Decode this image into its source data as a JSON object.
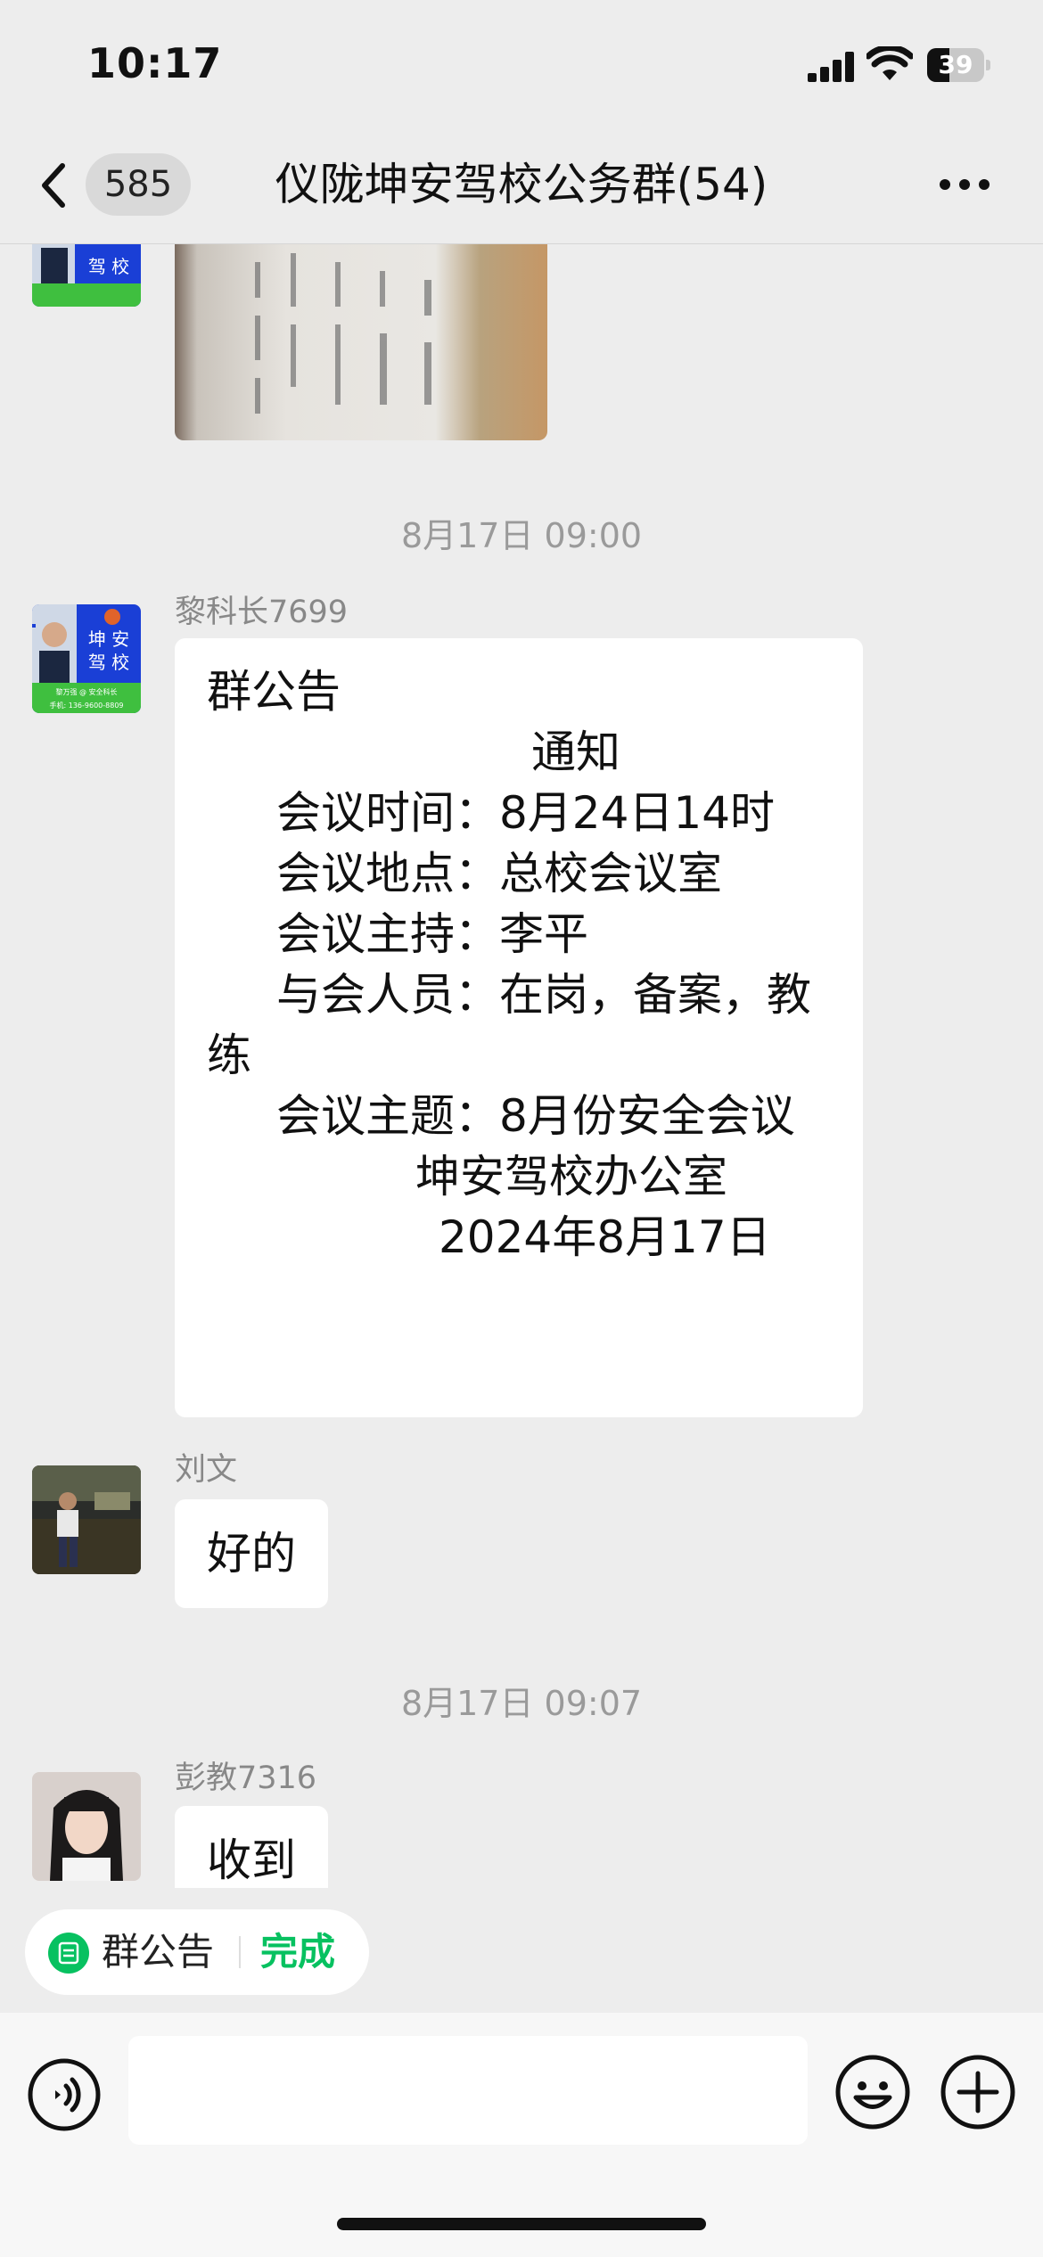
{
  "status_bar": {
    "time": "10:17",
    "battery_level": "39",
    "battery_fraction": 0.39
  },
  "nav": {
    "unread_count": "585",
    "title": "仪陇坤安驾校公务群(54)"
  },
  "avatars": {
    "school_badge_line1": "坤 安",
    "school_badge_line2": "驾 校",
    "school_badge_name": "黎万强 @ 安全科长",
    "school_badge_phone": "手机: 136-9600-8809"
  },
  "messages": [
    {
      "type": "timestamp",
      "text": "8月17日 09:00"
    },
    {
      "type": "announcement",
      "sender": "黎科长7699",
      "header": "群公告",
      "lines": [
        "通知",
        "会议时间：8月24日14时",
        "会议地点：总校会议室",
        "会议主持：李平",
        "与会人员：在岗，备案，教",
        "练",
        "会议主题：8月份安全会议",
        "坤安驾校办公室",
        "2024年8月17日"
      ]
    },
    {
      "type": "text",
      "sender": "刘文",
      "text": "好的"
    },
    {
      "type": "timestamp",
      "text": "8月17日 09:07"
    },
    {
      "type": "text",
      "sender": "彭教7316",
      "text": "收到"
    }
  ],
  "pinned": {
    "label": "群公告",
    "action": "完成"
  },
  "input": {
    "placeholder": ""
  },
  "colors": {
    "background": "#ededed",
    "accent_green": "#07c160",
    "bubble": "#ffffff",
    "school_blue": "#1a3fd6"
  },
  "icons": {
    "back": "chevron-left-icon",
    "more": "more-dots-icon",
    "voice": "voice-icon",
    "emoji": "emoji-icon",
    "plus": "plus-icon",
    "pin": "announcement-icon"
  }
}
